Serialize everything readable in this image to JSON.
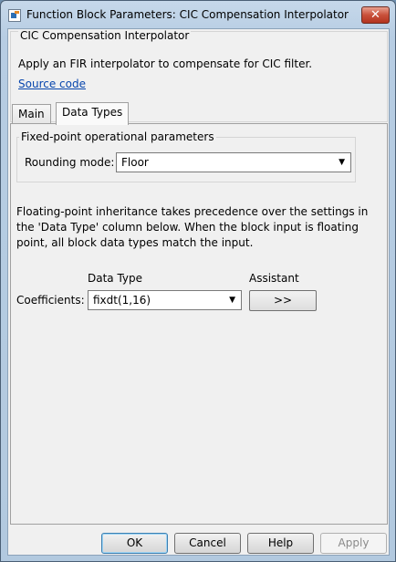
{
  "window": {
    "title": "Function Block Parameters: CIC Compensation Interpolator",
    "close_glyph": "✕"
  },
  "header": {
    "group_title": "CIC Compensation Interpolator",
    "description": "Apply an FIR interpolator to compensate for CIC filter.",
    "source_link": "Source code"
  },
  "tabs": [
    {
      "label": "Main",
      "active": false
    },
    {
      "label": "Data Types",
      "active": true
    }
  ],
  "data_types": {
    "fixed_point_title": "Fixed-point operational parameters",
    "rounding_label": "Rounding mode:",
    "rounding_value": "Floor",
    "info": "Floating-point inheritance takes precedence over the settings in the 'Data Type' column below. When the block input is floating point, all block data types match the input.",
    "col_data_type": "Data Type",
    "col_assistant": "Assistant",
    "coeff_label": "Coefficients:",
    "coeff_value": "fixdt(1,16)",
    "assistant_button": ">>"
  },
  "buttons": {
    "ok": "OK",
    "cancel": "Cancel",
    "help": "Help",
    "apply": "Apply"
  },
  "icons": {
    "dropdown_arrow": "▼"
  },
  "colors": {
    "link": "#0645ad",
    "close_button": "#c9503a"
  }
}
